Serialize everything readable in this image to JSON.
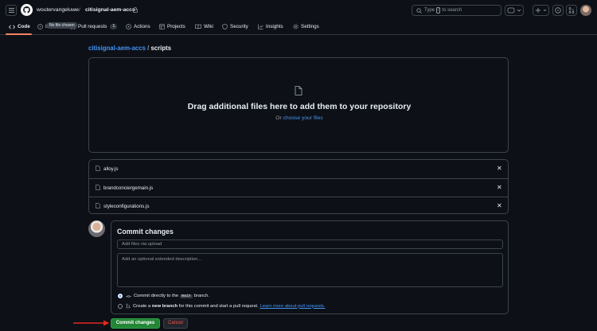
{
  "header": {
    "owner": "woutervangeluwe",
    "separator": "/",
    "repo": "citisignal-aem-accs",
    "search_prefix": "Type",
    "search_slash": "/",
    "search_suffix": "to search"
  },
  "tabs": [
    {
      "label": "Code",
      "icon": "code-icon",
      "active": true
    },
    {
      "label": "Issues",
      "icon": "issue-icon"
    },
    {
      "label": "Pull requests",
      "icon": "pull-request-icon",
      "count": "1"
    },
    {
      "label": "Actions",
      "icon": "play-icon"
    },
    {
      "label": "Projects",
      "icon": "table-icon"
    },
    {
      "label": "Wiki",
      "icon": "book-icon"
    },
    {
      "label": "Security",
      "icon": "shield-icon"
    },
    {
      "label": "Insights",
      "icon": "graph-icon"
    },
    {
      "label": "Settings",
      "icon": "gear-icon"
    }
  ],
  "tooltip": "No file chosen",
  "path": {
    "repo": "citisignal-aem-accs",
    "separator": "/",
    "folder": "scripts"
  },
  "dropzone": {
    "title": "Drag additional files here to add them to your repository",
    "prefix": "Or",
    "link": "choose your files"
  },
  "files": [
    {
      "name": "alloy.js"
    },
    {
      "name": "brandconciergemain.js"
    },
    {
      "name": "styleconfigurations.js"
    }
  ],
  "commit": {
    "title": "Commit changes",
    "summary_placeholder": "Add files via upload",
    "description_placeholder": "Add an optional extended description...",
    "option_direct_pre": "Commit directly to the",
    "option_direct_branch": "main",
    "option_direct_post": "branch.",
    "option_new_pre": "Create a",
    "option_new_bold": "new branch",
    "option_new_post": "for this commit and start a pull request.",
    "option_new_link": "Learn more about pull requests.",
    "submit_label": "Commit changes",
    "cancel_label": "Cancel"
  },
  "colors": {
    "background": "#0d1117",
    "accent_link": "#4493f8",
    "primary_button": "#238636",
    "danger_text": "#f85149",
    "tab_underline": "#f78166",
    "annotation_arrow": "#e5271f"
  }
}
